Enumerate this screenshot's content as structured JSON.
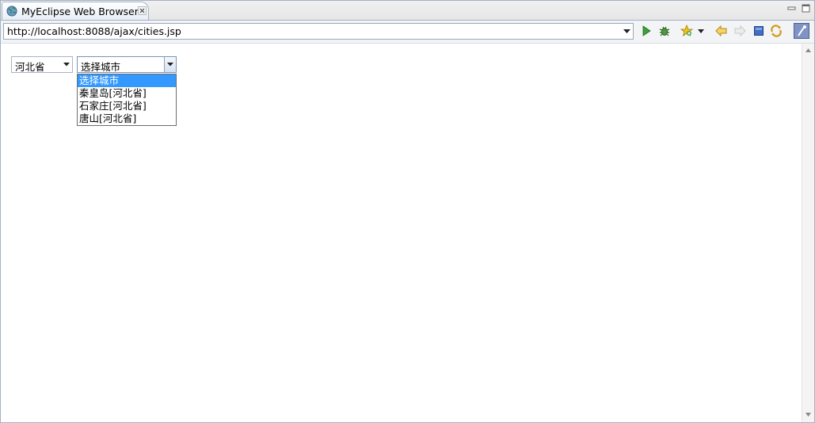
{
  "tab": {
    "title": "MyEclipse Web Browser"
  },
  "toolbar": {
    "url": "http://localhost:8088/ajax/cities.jsp",
    "buttons": [
      "run-icon",
      "debug-icon",
      "favorites-icon",
      "back-icon",
      "forward-icon",
      "stop-icon",
      "refresh-icon",
      "settings-icon"
    ]
  },
  "page": {
    "province_select": {
      "value": "河北省"
    },
    "city_select": {
      "value": "选择城市",
      "options": [
        "选择城市",
        "秦皇岛[河北省]",
        "石家庄[河北省]",
        "唐山[河北省]"
      ],
      "selected_index": 0
    }
  },
  "colors": {
    "selection": "#3399ff",
    "tab_border": "#a5b1c5"
  }
}
